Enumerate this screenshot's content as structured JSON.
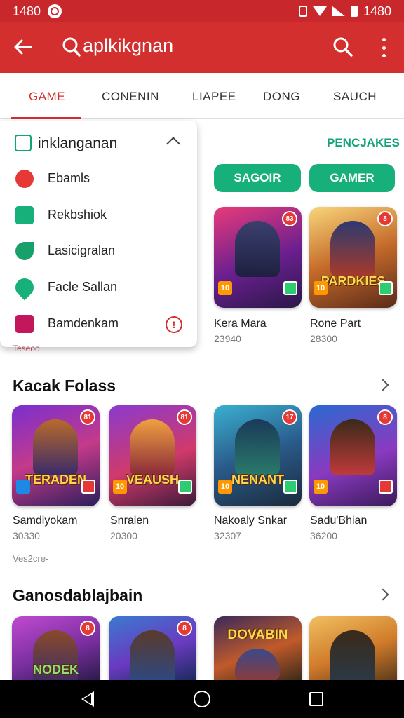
{
  "status_bar": {
    "time": "1480"
  },
  "app_bar": {
    "title": "aplkikgnan"
  },
  "tabs": [
    {
      "label": "GAME"
    },
    {
      "label": "CONENIN"
    },
    {
      "label": "LIAPEE"
    },
    {
      "label": "DONG"
    },
    {
      "label": "SAUCH"
    }
  ],
  "dropdown": {
    "header": "inklanganan",
    "items": [
      {
        "label": "Ebamls",
        "icon": "bug-icon"
      },
      {
        "label": "Rekbshiok",
        "icon": "window-icon"
      },
      {
        "label": "Lasicigralan",
        "icon": "leaf-icon"
      },
      {
        "label": "Facle Sallan",
        "icon": "location-icon"
      },
      {
        "label": "Bamdenkam",
        "icon": "ribbon-icon"
      }
    ],
    "peek_text": "Teseoo"
  },
  "top_section": {
    "link": "PENCJAKES",
    "pills": [
      "SAGOIR",
      "GAMER"
    ],
    "games": [
      {
        "name": "Kera Mara",
        "sub": "23940",
        "banner": "",
        "badge": "10",
        "corner": "83"
      },
      {
        "name": "Rone Part",
        "sub": "28300",
        "banner": "PARDKIES",
        "badge": "10",
        "corner": "8"
      }
    ]
  },
  "section2": {
    "title": "Kacak Folass",
    "games": [
      {
        "name": "Samdiyokam",
        "sub": "30330",
        "banner": "TERADEN",
        "badge": "",
        "corner": "81"
      },
      {
        "name": "Snralen",
        "sub": "20300",
        "banner": "VEAUSH",
        "badge": "10",
        "corner": "81"
      },
      {
        "name": "Nakoaly Snkar",
        "sub": "32307",
        "banner": "NENANT",
        "badge": "10",
        "corner": "17"
      },
      {
        "name": "Sadu'Bhian",
        "sub": "36200",
        "banner": "",
        "badge": "10",
        "corner": "8"
      }
    ],
    "footnote": "Ves2cre-"
  },
  "section3": {
    "title": "Ganosdablajbain",
    "games": [
      {
        "banner": "NODEK",
        "corner": "8"
      },
      {
        "banner": "",
        "corner": "8"
      },
      {
        "banner": "DOVABIN",
        "corner": ""
      },
      {
        "banner": "",
        "corner": ""
      }
    ]
  },
  "colors": {
    "primary": "#d32f2f",
    "accent": "#18b07a"
  }
}
